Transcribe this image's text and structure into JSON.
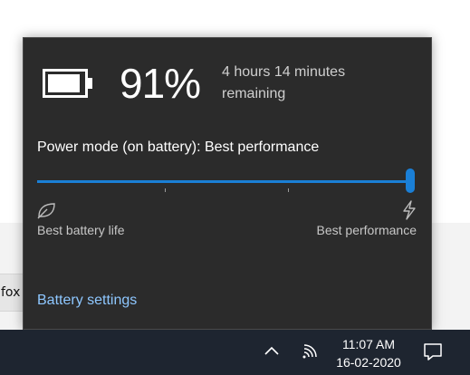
{
  "battery": {
    "percent_text": "91%",
    "level": 0.91,
    "remaining_line1": "4 hours 14 minutes",
    "remaining_line2": "remaining"
  },
  "power_mode": {
    "label": "Power mode (on battery): Best performance",
    "slider_value_fraction": 1.0,
    "left_label": "Best battery life",
    "right_label": "Best performance"
  },
  "links": {
    "battery_settings": "Battery settings"
  },
  "background": {
    "partial_window_text": "fox"
  },
  "taskbar": {
    "time": "11:07 AM",
    "date": "16-02-2020"
  },
  "colors": {
    "accent": "#1a7fd6",
    "link": "#8ec7ff",
    "flyout_bg": "#2b2b2b",
    "taskbar_bg": "#1e2530"
  },
  "icons": {
    "battery": "battery-icon",
    "leaf": "leaf-icon",
    "bolt": "bolt-icon",
    "chevron": "chevron-up-icon",
    "wifi": "wifi-icon",
    "notifications": "notification-icon"
  }
}
